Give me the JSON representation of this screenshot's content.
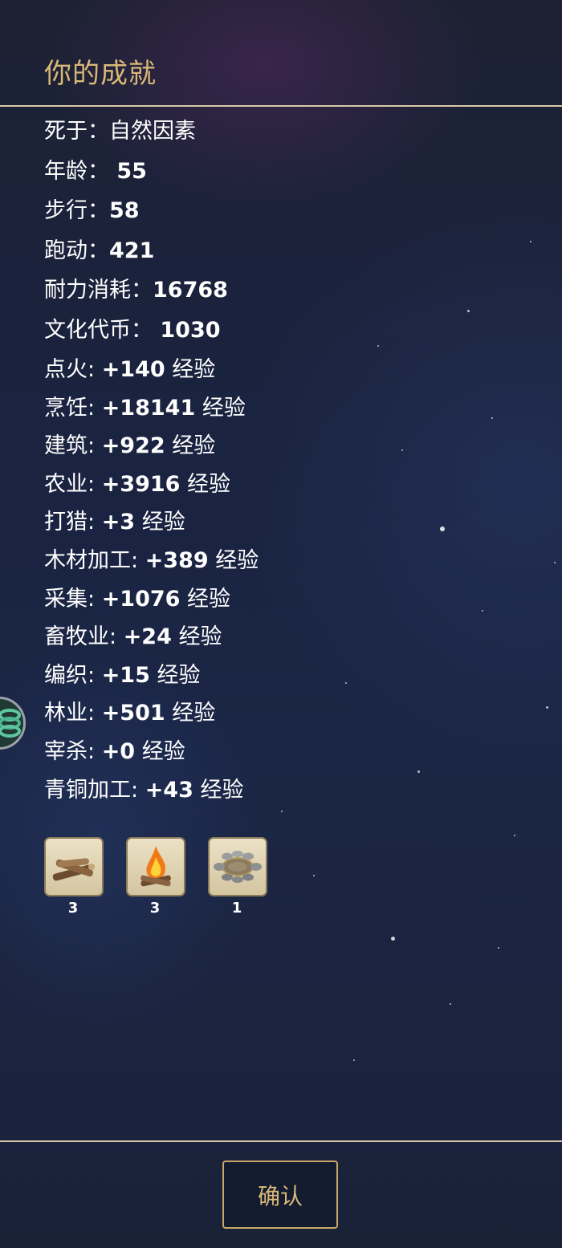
{
  "header": {
    "title": "你的成就"
  },
  "stats": [
    {
      "label": "死于：",
      "value": "自然因素"
    },
    {
      "label": "年龄：",
      "value": " 55"
    },
    {
      "label": "步行：",
      "value": "58"
    },
    {
      "label": "跑动：",
      "value": "421"
    },
    {
      "label": "耐力消耗：",
      "value": "16768"
    },
    {
      "label": "文化代币：",
      "value": " 1030"
    }
  ],
  "skills": [
    {
      "label": "点火: ",
      "value": "+140",
      "unit": " 经验"
    },
    {
      "label": "烹饪: ",
      "value": "+18141",
      "unit": " 经验"
    },
    {
      "label": "建筑: ",
      "value": "+922",
      "unit": " 经验"
    },
    {
      "label": "农业: ",
      "value": "+3916",
      "unit": " 经验"
    },
    {
      "label": "打猎: ",
      "value": "+3",
      "unit": " 经验"
    },
    {
      "label": "木材加工: ",
      "value": "+389",
      "unit": " 经验"
    },
    {
      "label": "采集: ",
      "value": "+1076",
      "unit": " 经验"
    },
    {
      "label": "畜牧业: ",
      "value": "+24",
      "unit": " 经验"
    },
    {
      "label": "编织: ",
      "value": "+15",
      "unit": " 经验"
    },
    {
      "label": "林业: ",
      "value": "+501",
      "unit": " 经验"
    },
    {
      "label": "宰杀: ",
      "value": "+0",
      "unit": " 经验"
    },
    {
      "label": "青铜加工: ",
      "value": "+43",
      "unit": " 经验"
    }
  ],
  "items": [
    {
      "icon": "firewood-icon",
      "count": "3"
    },
    {
      "icon": "campfire-icon",
      "count": "3"
    },
    {
      "icon": "stone-fire-pit-icon",
      "count": "1"
    }
  ],
  "colors": {
    "gold": "#d8b877",
    "divider": "#d9c9a6",
    "text": "#ffffff"
  },
  "footer": {
    "confirm_label": "确认"
  }
}
